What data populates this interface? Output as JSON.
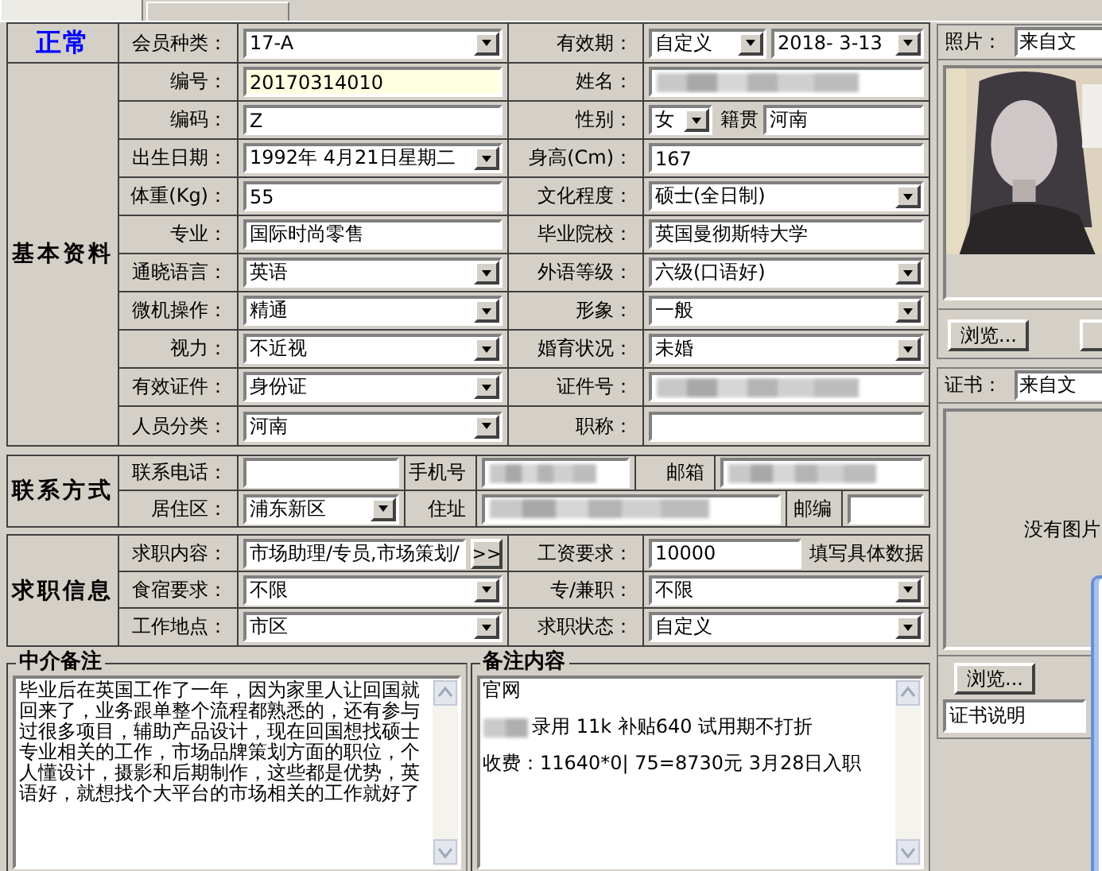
{
  "tabs": [
    {
      "selected": true
    },
    {
      "selected": false
    }
  ],
  "sections": [
    {
      "kind": "status",
      "title": "正常",
      "rows": [
        {
          "pairs": [
            {
              "label": "会员种类：",
              "controls": [
                {
                  "kind": "combo",
                  "value": "17-A"
                }
              ]
            },
            {
              "label": "有效期：",
              "controls": [
                {
                  "kind": "combo",
                  "value": "自定义"
                },
                {
                  "kind": "combo",
                  "value": "2018- 3-13"
                }
              ]
            }
          ]
        }
      ]
    },
    {
      "kind": "basic",
      "title": "基本资料",
      "rows": [
        {
          "pairs": [
            {
              "label": "编号：",
              "controls": [
                {
                  "kind": "text",
                  "value": "20170314010",
                  "focused": true
                }
              ]
            },
            {
              "label": "姓名：",
              "controls": [
                {
                  "kind": "redacted"
                }
              ]
            }
          ]
        },
        {
          "pairs": [
            {
              "label": "编码：",
              "controls": [
                {
                  "kind": "text",
                  "value": "Z",
                  "focused": false
                }
              ]
            },
            {
              "label": "性别：",
              "controls": [
                {
                  "kind": "combo",
                  "value": "女"
                },
                {
                  "kind": "caption",
                  "text": "籍贯"
                },
                {
                  "kind": "text",
                  "value": "河南",
                  "focused": false
                }
              ]
            }
          ]
        },
        {
          "pairs": [
            {
              "label": "出生日期：",
              "controls": [
                {
                  "kind": "combo",
                  "value": "1992年 4月21日星期二"
                }
              ]
            },
            {
              "label": "身高(Cm)：",
              "controls": [
                {
                  "kind": "text",
                  "value": "167",
                  "focused": false
                }
              ]
            }
          ]
        },
        {
          "pairs": [
            {
              "label": "体重(Kg)：",
              "controls": [
                {
                  "kind": "text",
                  "value": "55",
                  "focused": false
                }
              ]
            },
            {
              "label": "文化程度：",
              "controls": [
                {
                  "kind": "combo",
                  "value": "硕士(全日制)"
                }
              ]
            }
          ]
        },
        {
          "pairs": [
            {
              "label": "专业：",
              "controls": [
                {
                  "kind": "text",
                  "value": "国际时尚零售",
                  "focused": false
                }
              ]
            },
            {
              "label": "毕业院校：",
              "controls": [
                {
                  "kind": "text",
                  "value": "英国曼彻斯特大学",
                  "focused": false
                }
              ]
            }
          ]
        },
        {
          "pairs": [
            {
              "label": "通晓语言：",
              "controls": [
                {
                  "kind": "combo",
                  "value": "英语"
                }
              ]
            },
            {
              "label": "外语等级：",
              "controls": [
                {
                  "kind": "combo",
                  "value": "六级(口语好)"
                }
              ]
            }
          ]
        },
        {
          "pairs": [
            {
              "label": "微机操作：",
              "controls": [
                {
                  "kind": "combo",
                  "value": "精通"
                }
              ]
            },
            {
              "label": "形象：",
              "controls": [
                {
                  "kind": "combo",
                  "value": "一般"
                }
              ]
            }
          ]
        },
        {
          "pairs": [
            {
              "label": "视力：",
              "controls": [
                {
                  "kind": "combo",
                  "value": "不近视"
                }
              ]
            },
            {
              "label": "婚育状况：",
              "controls": [
                {
                  "kind": "combo",
                  "value": "未婚"
                }
              ]
            }
          ]
        },
        {
          "pairs": [
            {
              "label": "有效证件：",
              "controls": [
                {
                  "kind": "combo",
                  "value": "身份证"
                }
              ]
            },
            {
              "label": "证件号：",
              "controls": [
                {
                  "kind": "redacted"
                }
              ]
            }
          ]
        },
        {
          "pairs": [
            {
              "label": "人员分类：",
              "controls": [
                {
                  "kind": "combo",
                  "value": "河南"
                }
              ]
            },
            {
              "label": "职称：",
              "controls": [
                {
                  "kind": "text",
                  "focused": false
                }
              ]
            }
          ]
        }
      ]
    },
    {
      "kind": "contact",
      "title": "联系方式",
      "rows": [
        {
          "pairs": [
            {
              "label": "联系电话：",
              "controls": [
                {
                  "kind": "text"
                }
              ]
            },
            {
              "label": "手机号",
              "controls": [
                {
                  "kind": "redacted"
                }
              ]
            },
            {
              "label": "邮箱",
              "controls": [
                {
                  "kind": "redacted"
                }
              ]
            }
          ]
        },
        {
          "pairs": [
            {
              "label": "居住区：",
              "controls": [
                {
                  "kind": "combo",
                  "value": "浦东新区"
                }
              ]
            },
            {
              "label": "住址",
              "controls": [
                {
                  "kind": "redacted"
                }
              ]
            },
            {
              "label": "邮编",
              "controls": [
                {
                  "kind": "text"
                }
              ]
            }
          ]
        }
      ]
    },
    {
      "kind": "job",
      "title": "求职信息",
      "rows": [
        {
          "pairs": [
            {
              "label": "求职内容：",
              "controls": [
                {
                  "kind": "text",
                  "value": "市场助理/专员,市场策划/"
                },
                {
                  "kind": "button",
                  "text": ">>"
                }
              ]
            },
            {
              "label": "工资要求：",
              "controls": [
                {
                  "kind": "text",
                  "value": "10000"
                },
                {
                  "kind": "caption",
                  "text": "填写具体数据"
                }
              ]
            }
          ]
        },
        {
          "pairs": [
            {
              "label": "食宿要求：",
              "controls": [
                {
                  "kind": "combo",
                  "value": "不限"
                }
              ]
            },
            {
              "label": "专/兼职：",
              "controls": [
                {
                  "kind": "combo",
                  "value": "不限"
                }
              ]
            }
          ]
        },
        {
          "pairs": [
            {
              "label": "工作地点：",
              "controls": [
                {
                  "kind": "combo",
                  "value": "市区"
                }
              ]
            },
            {
              "label": "求职状态：",
              "controls": [
                {
                  "kind": "combo",
                  "value": "自定义"
                }
              ]
            }
          ]
        }
      ]
    }
  ],
  "agent_notes": {
    "title": "中介备注",
    "text": "毕业后在英国工作了一年，因为家里人让回国就回来了，业务跟单整个流程都熟悉的，还有参与过很多项目，辅助产品设计，现在回国想找硕士专业相关的工作，市场品牌策划方面的职位，个人懂设计，摄影和后期制作，这些都是优势，英语好，就想找个大平台的市场相关的工作就好了"
  },
  "remarks": {
    "title": "备注内容",
    "lines": [
      {
        "text": "官网",
        "redacted_prefix": false
      },
      {
        "text": "录用 11k 补贴640 试用期不打折",
        "redacted_prefix": true
      },
      {
        "text": "收费：11640*0| 75=8730元 3月28日入职",
        "redacted_prefix": false
      }
    ]
  },
  "photo": {
    "label": "照片：",
    "source": "来自文",
    "browse": "浏览..."
  },
  "certificate": {
    "label": "证书：",
    "source": "来自文",
    "empty_text": "没有图片",
    "browse": "浏览...",
    "description": "证书说明"
  }
}
